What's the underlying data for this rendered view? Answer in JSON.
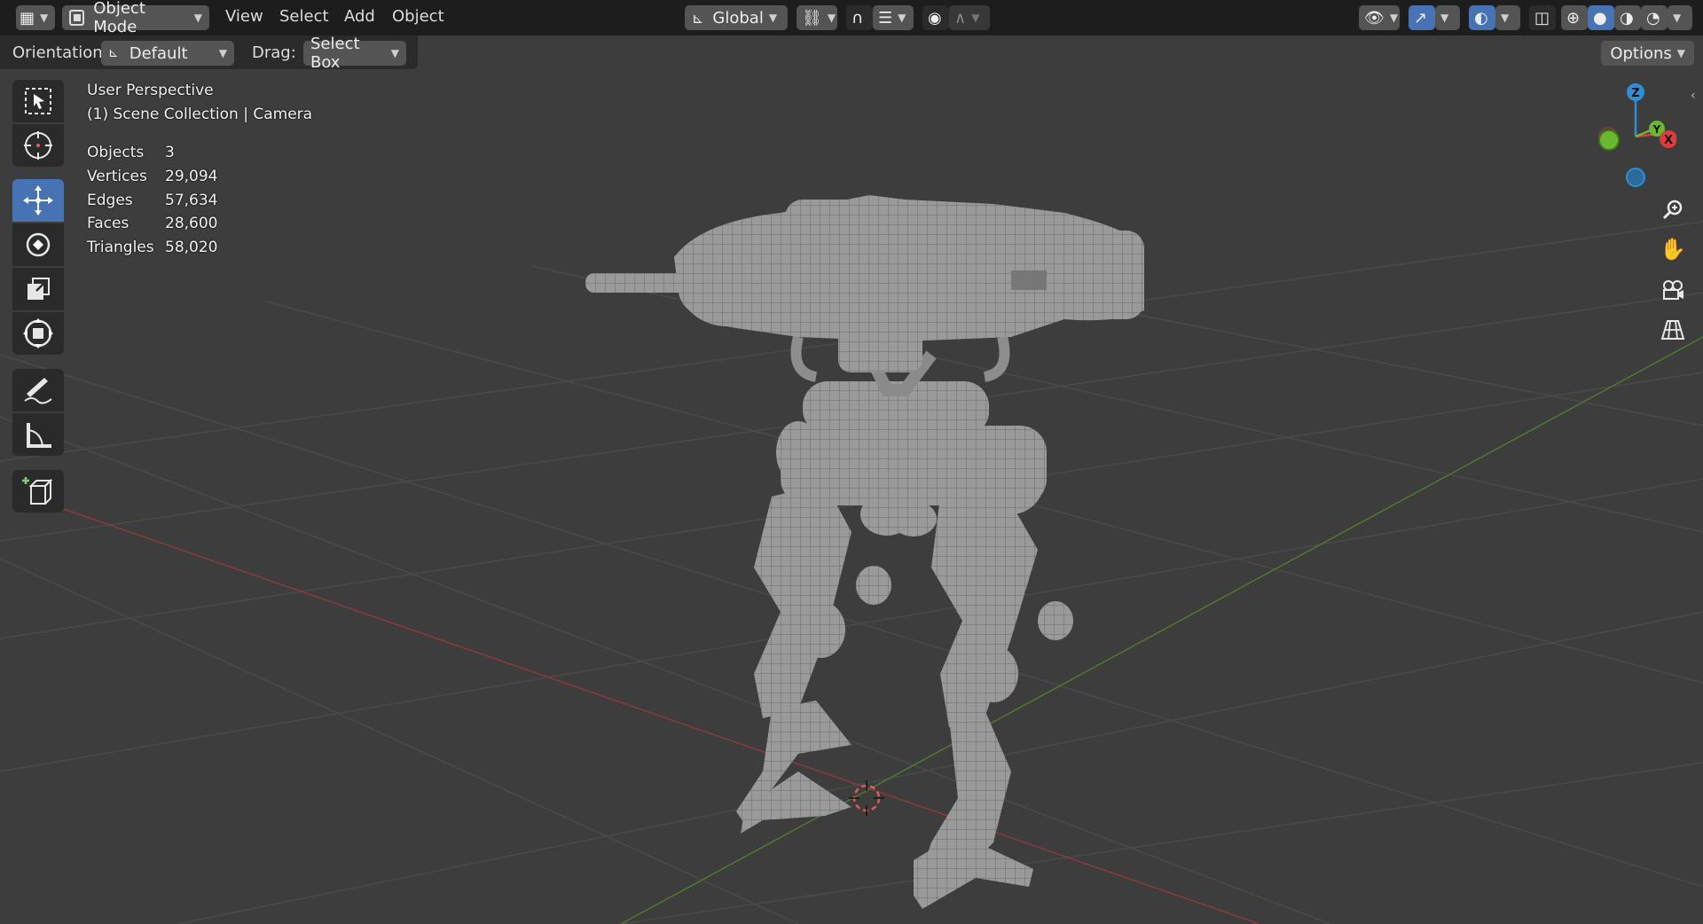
{
  "header": {
    "editor_type_icon": "grid-editor-icon",
    "mode": "Object Mode",
    "menus": [
      "View",
      "Select",
      "Add",
      "Object"
    ],
    "transform_orientation": "Global"
  },
  "tool_settings": {
    "orientation_label": "Orientation:",
    "orientation_value": "Default",
    "drag_label": "Drag:",
    "drag_value": "Select Box",
    "options_label": "Options"
  },
  "viewport": {
    "view_name": "User Perspective",
    "collection": "(1) Scene Collection | Camera",
    "stats": [
      {
        "label": "Objects",
        "value": "3"
      },
      {
        "label": "Vertices",
        "value": "29,094"
      },
      {
        "label": "Edges",
        "value": "57,634"
      },
      {
        "label": "Faces",
        "value": "28,600"
      },
      {
        "label": "Triangles",
        "value": "58,020"
      }
    ]
  },
  "gizmo": {
    "z": "Z",
    "y": "Y",
    "x": "X"
  },
  "tools": [
    {
      "name": "select-box-tool",
      "icon": "select-box-icon",
      "active": false
    },
    {
      "name": "cursor-tool",
      "icon": "cursor-icon",
      "active": false
    },
    {
      "name": "move-tool",
      "icon": "move-icon",
      "active": true
    },
    {
      "name": "rotate-tool",
      "icon": "rotate-icon",
      "active": false
    },
    {
      "name": "scale-tool",
      "icon": "scale-icon",
      "active": false
    },
    {
      "name": "transform-tool",
      "icon": "transform-icon",
      "active": false
    },
    {
      "name": "annotate-tool",
      "icon": "annotate-icon",
      "active": false
    },
    {
      "name": "measure-tool",
      "icon": "measure-icon",
      "active": false
    },
    {
      "name": "add-cube-tool",
      "icon": "add-cube-icon",
      "active": false
    }
  ],
  "colors": {
    "header_bg": "#1d1d1d",
    "viewport_bg": "#3d3d3d",
    "active_tool": "#4772b3",
    "x_axis": "#e03a3a",
    "y_axis": "#6ab82f",
    "z_axis": "#2e8fd6"
  }
}
